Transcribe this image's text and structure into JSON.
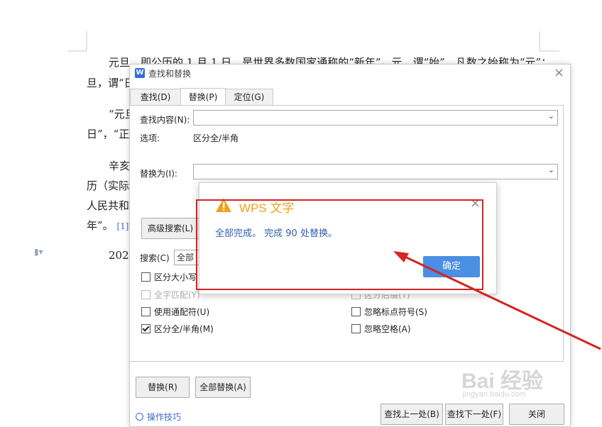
{
  "document": {
    "lines": [
      "元旦，即公历的 1 月 1 日，是世界多数国家通称的“新年”。元，谓“始”，凡数之始称为“元”；",
      "旦，谓“日",
      "“元旦",
      "日”，“正",
      "辛亥",
      "历（实际",
      "人民共和",
      "年”。",
      "202"
    ],
    "ref": "[1]"
  },
  "dialog": {
    "title": "查找和替换",
    "tabs": [
      "查找(D)",
      "替换(P)",
      "定位(G)"
    ],
    "find_label": "查找内容(N):",
    "find_value": "",
    "options_label": "选项:",
    "options_value": "区分全/半角",
    "replace_label": "替换为(I):",
    "replace_value": "",
    "advanced_button": "高级搜索(L)",
    "search_label": "搜索(C)",
    "search_value": "全部",
    "checkboxes": [
      {
        "label": "区分大小写",
        "checked": false,
        "disabled": false
      },
      {
        "label": "全字匹配(Y)",
        "checked": false,
        "disabled": true
      },
      {
        "label": "使用通配符(U)",
        "checked": false,
        "disabled": false
      },
      {
        "label": "区分全/半角(M)",
        "checked": true,
        "disabled": false
      },
      {
        "label": "区分后缀(T)",
        "checked": false,
        "disabled": true
      },
      {
        "label": "忽略标点符号(S)",
        "checked": false,
        "disabled": false
      },
      {
        "label": "忽略空格(A)",
        "checked": false,
        "disabled": false
      }
    ],
    "replace_button": "替换(R)",
    "replace_all_button": "全部替换(A)",
    "tips_link": "操作技巧",
    "find_prev_button": "查找上一处(B)",
    "find_next_button": "查找下一处(F)",
    "close_button": "关闭"
  },
  "message_box": {
    "title": "WPS 文字",
    "text": "全部完成。 完成 90 处替换。",
    "ok_button": "确定"
  },
  "watermark": {
    "main": "Bai 经验",
    "sub": "jingyan.baidu.com"
  },
  "colors": {
    "accent": "#4a8fe3",
    "warning": "#f0a11a",
    "annotation": "#d42424"
  }
}
